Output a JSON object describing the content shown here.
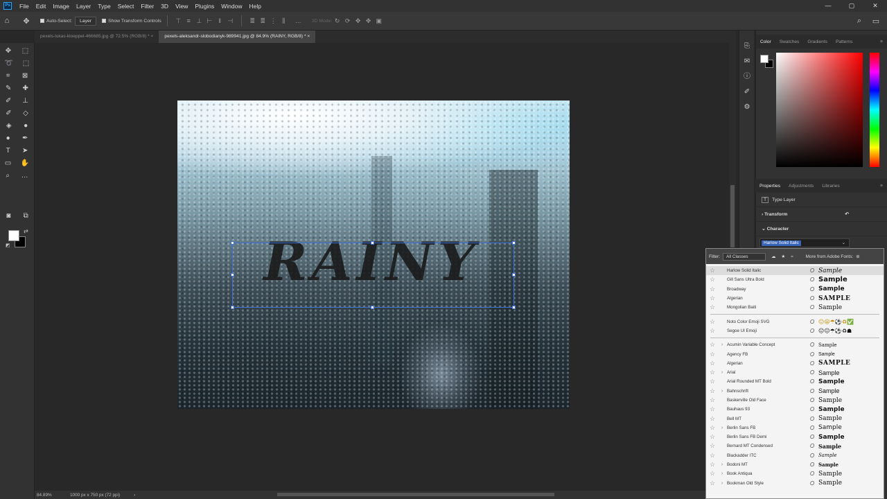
{
  "menu": [
    "File",
    "Edit",
    "Image",
    "Layer",
    "Type",
    "Select",
    "Filter",
    "3D",
    "View",
    "Plugins",
    "Window",
    "Help"
  ],
  "app_icon": "Ps",
  "window_controls": [
    "—",
    "▢",
    "✕"
  ],
  "options": {
    "auto_select_label": "Auto-Select:",
    "auto_select_value": "Layer",
    "show_transform_label": "Show Transform Controls",
    "mode_3d": "3D Mode:"
  },
  "tabs": [
    {
      "label": "pexels-lukas-kloeppel-466685.jpg @ 72.5% (RGB/8) *",
      "active": false
    },
    {
      "label": "pexels-aleksandr-slobodianyk-989941.jpg @ 84.9% (RAINY, RGB/8) *",
      "active": true
    }
  ],
  "canvas": {
    "text": "RAINY"
  },
  "status": {
    "zoom": "84.89%",
    "doc_size": "1000 px x 750 px (72 ppi)"
  },
  "color_panel": {
    "tabs": [
      "Color",
      "Swatches",
      "Gradients",
      "Patterns"
    ]
  },
  "properties": {
    "tabs": [
      "Properties",
      "Adjustments",
      "Libraries"
    ],
    "layer_type": "Type Layer",
    "transform": "Transform",
    "character": "Character",
    "font_value": "Harlow Solid Italic"
  },
  "font_menu": {
    "filter_label": "Filter:",
    "filter_value": "All Classes",
    "more_fonts": "More from Adobe Fonts:",
    "recent": [
      {
        "name": "Harlow Solid Italic",
        "sample": "Sample"
      },
      {
        "name": "Gill Sans Ultra Bold",
        "sample": "Sample"
      },
      {
        "name": "Broadway",
        "sample": "Sample"
      },
      {
        "name": "Algerian",
        "sample": "SAMPLE"
      },
      {
        "name": "Mongolian Baiti",
        "sample": "Sample"
      }
    ],
    "emoji": [
      {
        "name": "Noto Color Emoji SVG",
        "sample": "😐😦☂⚽♻✅"
      },
      {
        "name": "Segoe UI Emoji",
        "sample": "😐😐☂⚽♻☗"
      }
    ],
    "fonts": [
      {
        "name": "Acumin Variable Concept",
        "sample": "Sample"
      },
      {
        "name": "Agency FB",
        "sample": "Sample"
      },
      {
        "name": "Algerian",
        "sample": "SAMPLE"
      },
      {
        "name": "Arial",
        "sample": "Sample"
      },
      {
        "name": "Arial Rounded MT Bold",
        "sample": "Sample"
      },
      {
        "name": "Bahnschrift",
        "sample": "Sample"
      },
      {
        "name": "Baskerville Old Face",
        "sample": "Sample"
      },
      {
        "name": "Bauhaus 93",
        "sample": "Sample"
      },
      {
        "name": "Bell MT",
        "sample": "Sample"
      },
      {
        "name": "Berlin Sans FB",
        "sample": "Sample"
      },
      {
        "name": "Berlin Sans FB Demi",
        "sample": "Sample"
      },
      {
        "name": "Bernard MT Condensed",
        "sample": "Sample"
      },
      {
        "name": "Blackadder ITC",
        "sample": "Sample"
      },
      {
        "name": "Bodoni MT",
        "sample": "Sample"
      },
      {
        "name": "Book Antiqua",
        "sample": "Sample"
      },
      {
        "name": "Bookman Old Style",
        "sample": "Sample"
      }
    ]
  }
}
